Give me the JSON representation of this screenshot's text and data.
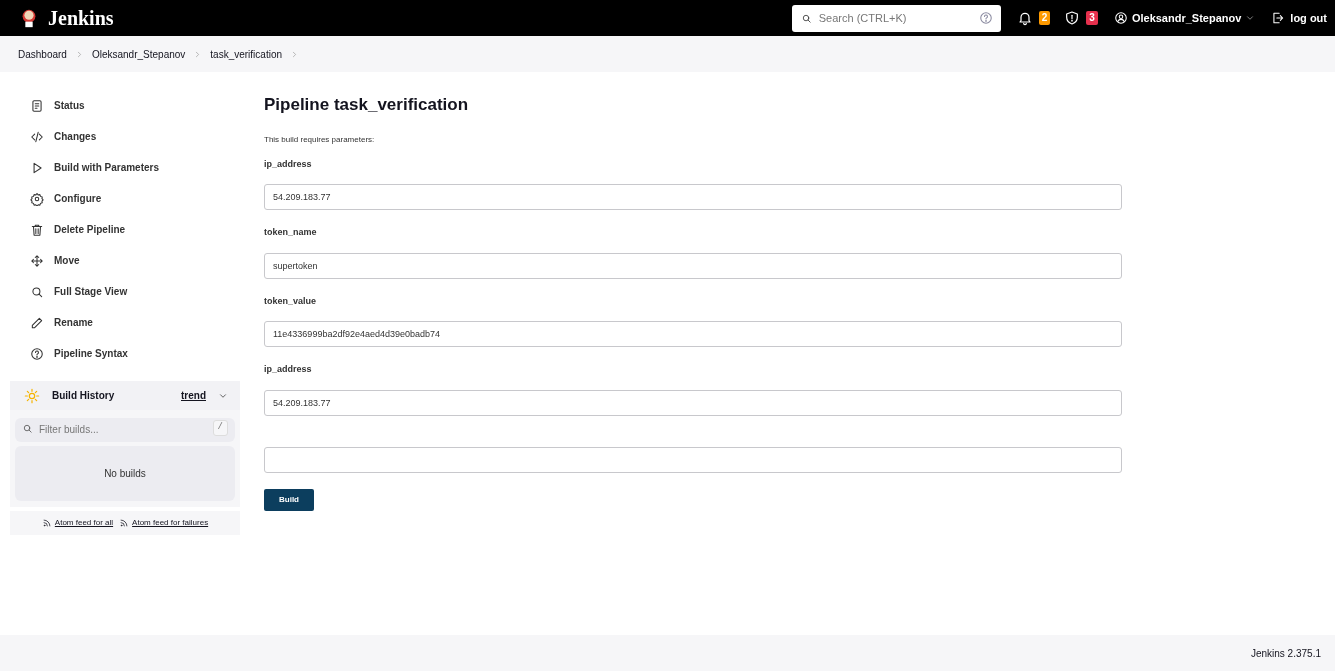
{
  "header": {
    "brand": "Jenkins",
    "search": {
      "placeholder": "Search (CTRL+K)"
    },
    "notifications": "2",
    "security": "3",
    "user": "Oleksandr_Stepanov",
    "logout": "log out"
  },
  "breadcrumbs": [
    "Dashboard",
    "Oleksandr_Stepanov",
    "task_verification"
  ],
  "sidebar": {
    "items": [
      "Status",
      "Changes",
      "Build with Parameters",
      "Configure",
      "Delete Pipeline",
      "Move",
      "Full Stage View",
      "Rename",
      "Pipeline Syntax"
    ],
    "build_history": {
      "title": "Build History",
      "trend": "trend",
      "filter": {
        "placeholder": "Filter builds...",
        "shortcut": "/"
      },
      "empty": "No builds",
      "feeds": [
        "Atom feed for all",
        "Atom feed for failures"
      ]
    }
  },
  "main": {
    "title": "Pipeline task_verification",
    "intro": "This build requires parameters:",
    "parameters": [
      {
        "kind": "string",
        "label": "ip_address",
        "value": "54.209.183.77"
      },
      {
        "kind": "string",
        "label": "token_name",
        "value": "supertoken"
      },
      {
        "kind": "string",
        "label": "token_value",
        "value": "11e4336999ba2df92e4aed4d39e0badb74"
      },
      {
        "kind": "string",
        "label": "ip_address",
        "value": "54.209.183.77"
      },
      {
        "kind": "string"
      }
    ],
    "button": "Build"
  },
  "footer": {
    "version": "Jenkins 2.375.1"
  }
}
